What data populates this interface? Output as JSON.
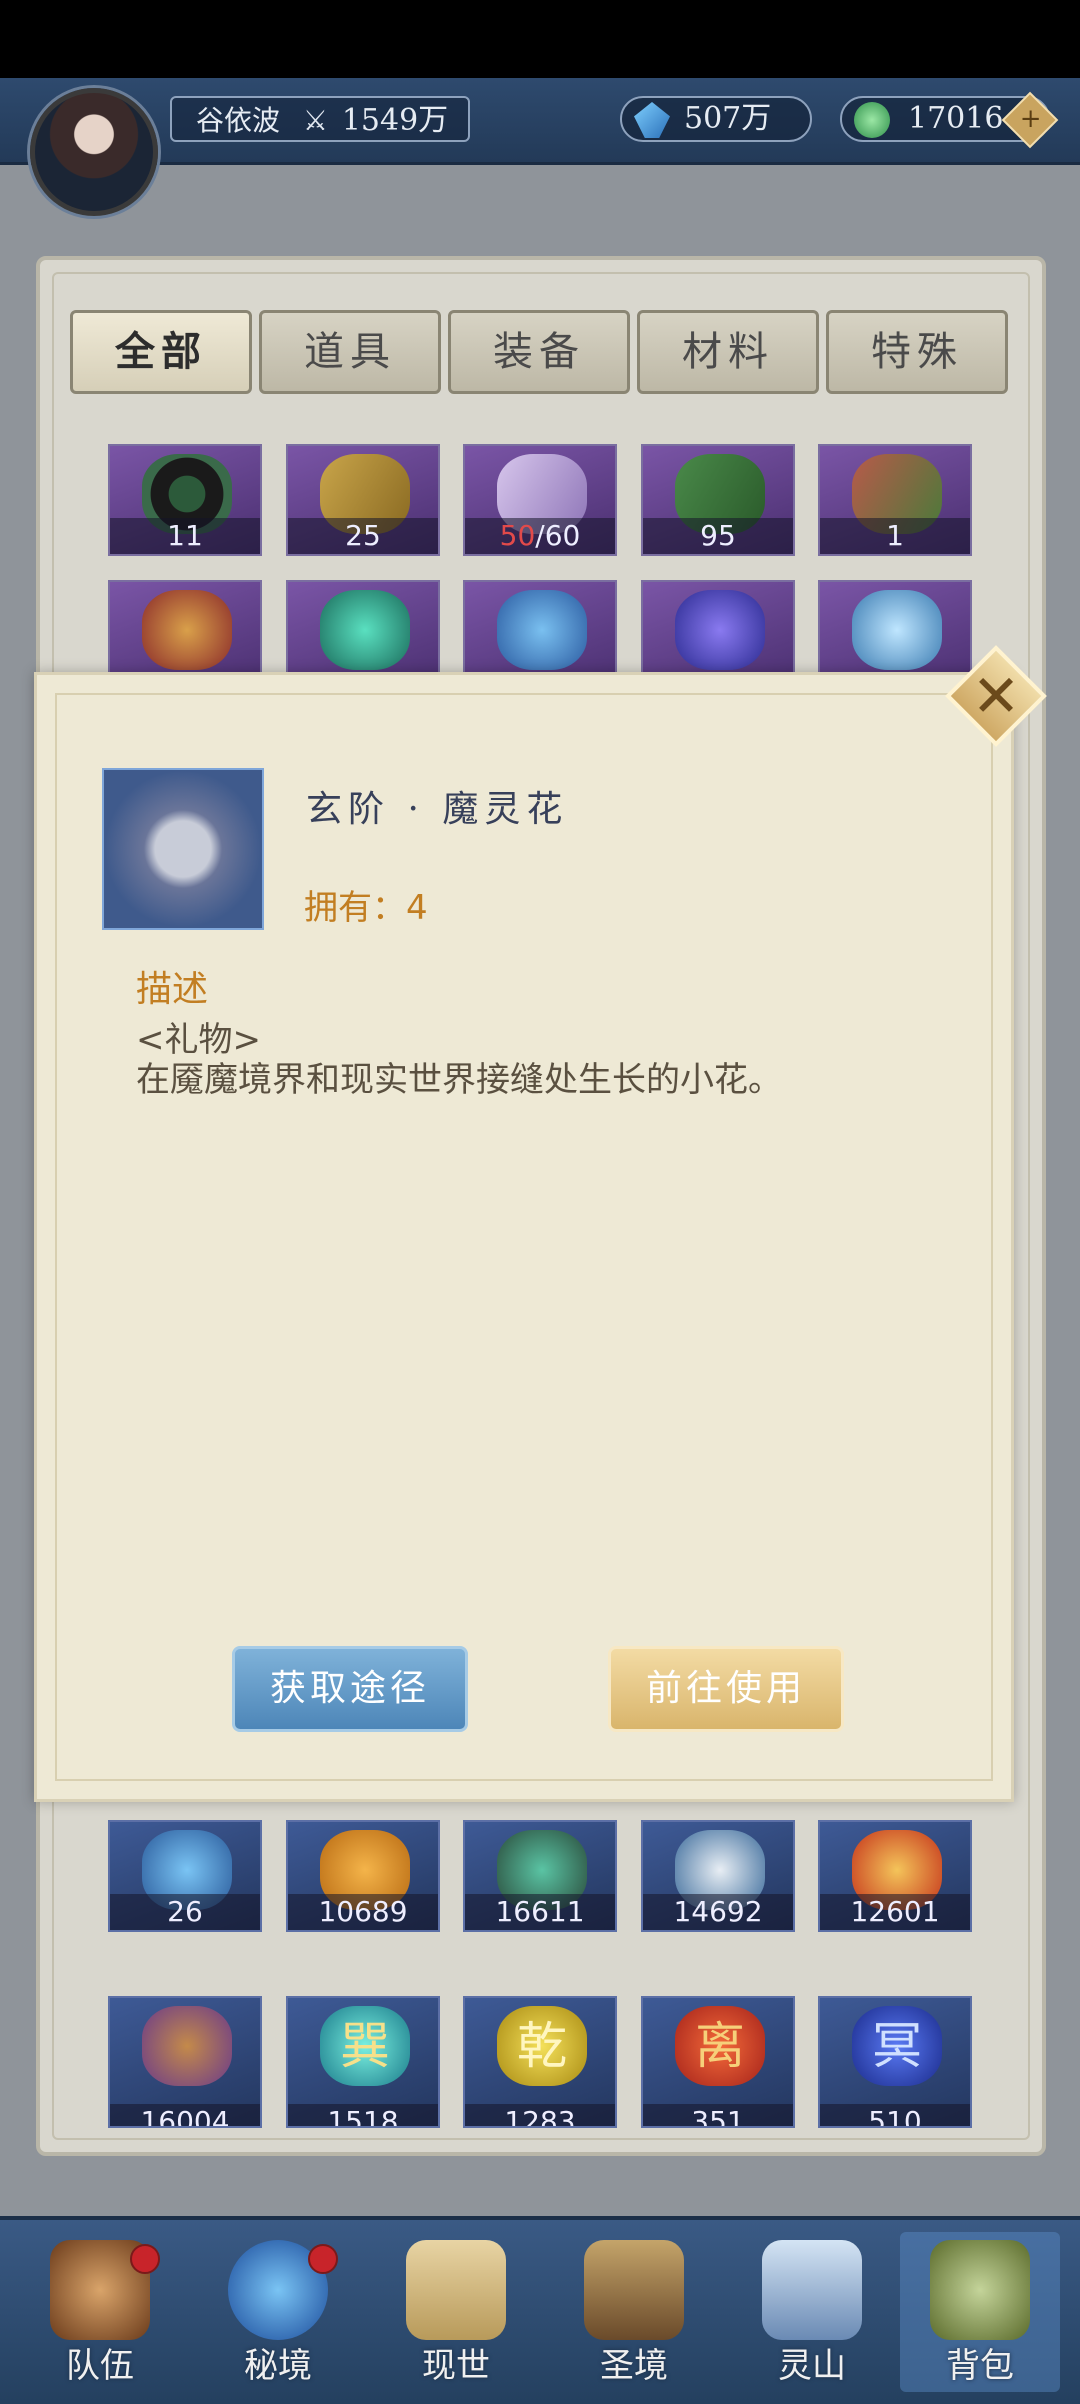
{
  "header": {
    "player_name": "谷依波",
    "power": "1549万",
    "gem_amount": "507万",
    "coin_amount": "17016",
    "add_label": "+"
  },
  "tabs": [
    {
      "label": "全部",
      "active": true
    },
    {
      "label": "道具",
      "active": false
    },
    {
      "label": "装备",
      "active": false
    },
    {
      "label": "材料",
      "active": false
    },
    {
      "label": "特殊",
      "active": false
    }
  ],
  "inventory_top": [
    {
      "count": "11"
    },
    {
      "count": "25"
    },
    {
      "count_red": "50",
      "count_rest": "/60"
    },
    {
      "count": "95"
    },
    {
      "count": "1"
    }
  ],
  "inventory_bottom_row1": [
    {
      "count": "26"
    },
    {
      "count": "10689"
    },
    {
      "count": "16611"
    },
    {
      "count": "14692"
    },
    {
      "count": "12601"
    }
  ],
  "inventory_bottom_row2": [
    {
      "count": "16004",
      "glyph": ""
    },
    {
      "count": "1518",
      "glyph": "巽"
    },
    {
      "count": "1283",
      "glyph": "乾"
    },
    {
      "count": "351",
      "glyph": "离"
    },
    {
      "count": "510",
      "glyph": "冥"
    }
  ],
  "dialog": {
    "item_name": "玄阶 · 魔灵花",
    "owned": "拥有：4",
    "desc_title": "描述",
    "desc_tag": "<礼物>",
    "desc_text": "在魇魔境界和现实世界接缝处生长的小花。",
    "btn_source": "获取途径",
    "btn_use": "前往使用",
    "close": "✕"
  },
  "nav": [
    {
      "label": "队伍",
      "dot": true
    },
    {
      "label": "秘境",
      "dot": true
    },
    {
      "label": "现世",
      "dot": false
    },
    {
      "label": "圣境",
      "dot": false
    },
    {
      "label": "灵山",
      "dot": false
    },
    {
      "label": "背包",
      "dot": false,
      "active": true
    }
  ]
}
